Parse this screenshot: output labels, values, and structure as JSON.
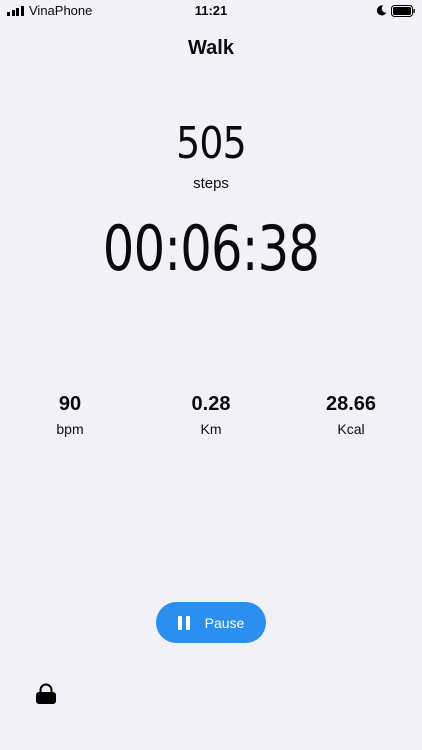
{
  "status_bar": {
    "carrier": "VinaPhone",
    "time": "11:21",
    "icons": [
      "signal-icon",
      "moon-icon",
      "battery-icon"
    ]
  },
  "header": {
    "title": "Walk"
  },
  "steps": {
    "value": "505",
    "label": "steps"
  },
  "timer": {
    "value": "00:06:38"
  },
  "stats": [
    {
      "value": "90",
      "unit": "bpm"
    },
    {
      "value": "0.28",
      "unit": "Km"
    },
    {
      "value": "28.66",
      "unit": "Kcal"
    }
  ],
  "controls": {
    "pause_label": "Pause",
    "pause_icon": "pause-icon",
    "lock_icon": "lock-icon"
  },
  "colors": {
    "background": "#f2f1f7",
    "accent": "#2a8fef",
    "text": "#0b0b0f"
  }
}
